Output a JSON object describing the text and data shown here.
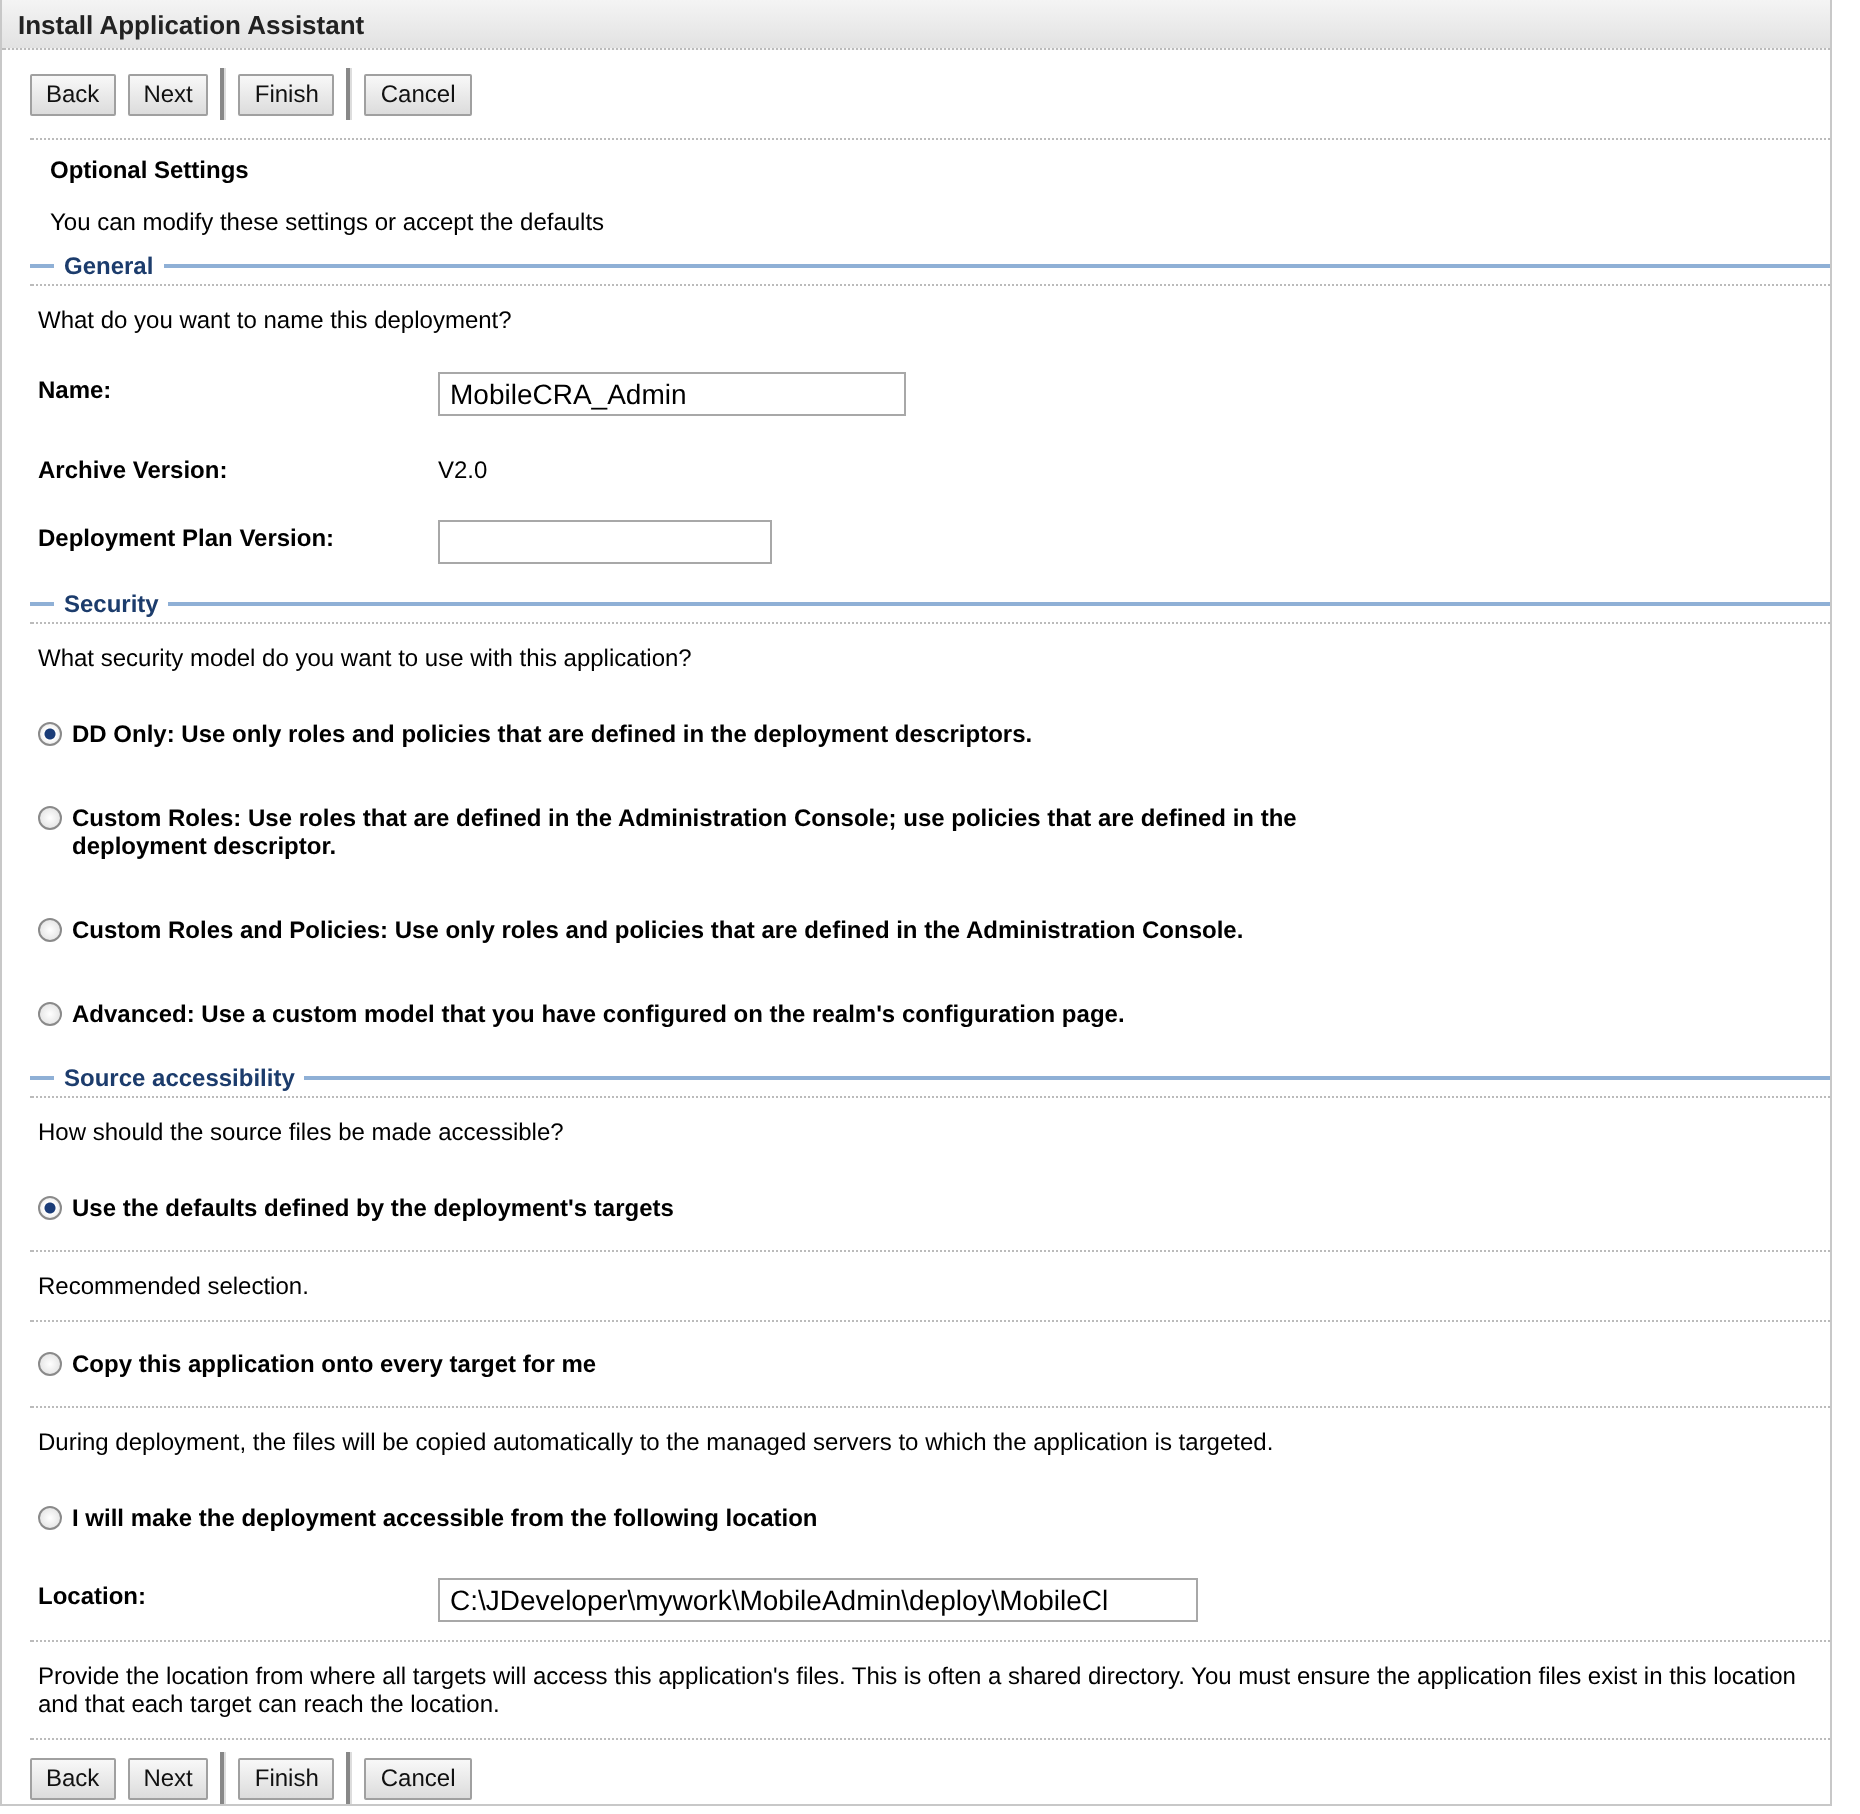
{
  "window": {
    "title": "Install Application Assistant"
  },
  "top_buttons": [
    "Back",
    "Next",
    "Finish",
    "Cancel"
  ],
  "header": {
    "title": "Optional Settings",
    "subtitle": "You can modify these settings or accept the defaults"
  },
  "sections": [
    {
      "title": "General",
      "items": [
        {
          "kind": "text",
          "text": "What do you want to name this deployment?"
        },
        {
          "kind": "field",
          "label": "Name:",
          "value": "MobileCRA_Admin"
        },
        {
          "kind": "value",
          "label": "Archive Version:",
          "value": "V2.0"
        },
        {
          "kind": "short_field",
          "label": "Deployment Plan Version:",
          "value": ""
        }
      ]
    },
    {
      "title": "Security",
      "items": [
        {
          "kind": "text",
          "text": "What security model do you want to use with this application?"
        },
        {
          "kind": "radio",
          "label": "DD Only: Use only roles and policies that are defined in the deployment descriptors.",
          "selected": true
        },
        {
          "kind": "radio",
          "label": "Custom Roles: Use roles that are defined in the Administration Console; use policies that are defined in the deployment descriptor.",
          "selected": false
        },
        {
          "kind": "radio",
          "label": "Custom Roles and Policies: Use only roles and policies that are defined in the Administration Console.",
          "selected": false
        },
        {
          "kind": "radio",
          "label": "Advanced: Use a custom model that you have configured on the realm's configuration page.",
          "selected": false
        }
      ]
    },
    {
      "title": "Source accessibility",
      "items": [
        {
          "kind": "text",
          "text": "How should the source files be made accessible?"
        },
        {
          "kind": "radio",
          "label": "Use the defaults defined by the deployment's targets",
          "selected": true
        },
        {
          "kind": "rule"
        },
        {
          "kind": "text",
          "text": "Recommended selection."
        },
        {
          "kind": "rule"
        },
        {
          "kind": "radio",
          "label": "Copy this application onto every target for me",
          "selected": false
        },
        {
          "kind": "rule"
        },
        {
          "kind": "text",
          "text": "During deployment, the files will be copied automatically to the managed servers to which the application is targeted."
        },
        {
          "kind": "radio",
          "label": "I will make the deployment accessible from the following location",
          "selected": false
        },
        {
          "label": "Location:",
          "value": "C:\\JDeveloper\\mywork\\MobileAdmin\\deploy\\MobileCl",
          "kind": "path_field"
        },
        {
          "kind": "rule"
        },
        {
          "kind": "text",
          "text": "Provide the location from where all targets will access this application's files. This is often a shared directory. You must ensure the application files exist in this location and that each target can reach the location."
        }
      ]
    }
  ],
  "bottom_buttons": [
    "Back",
    "Next",
    "Finish",
    "Cancel"
  ]
}
